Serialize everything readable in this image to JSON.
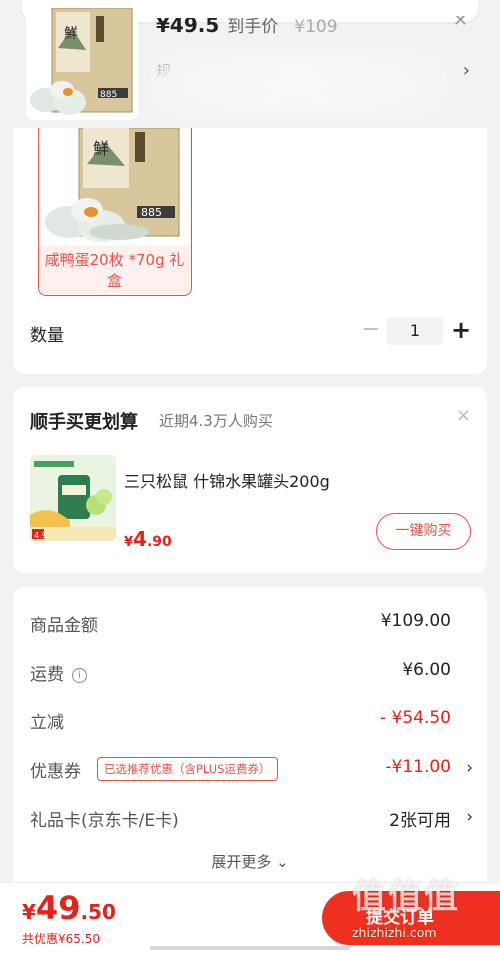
{
  "colors": {
    "accent_red": "#e2231a",
    "button_red": "#f0301e",
    "variant_border": "#e2564a",
    "page_bg": "#f2f2f2"
  },
  "top_product": {
    "price": "¥49.5",
    "price_suffix": "到手价",
    "original_price": "¥109",
    "spec_text": "规",
    "close_icon": "close-icon",
    "chevron_icon": "chevron-right-icon"
  },
  "variant": {
    "label": "咸鸭蛋20枚 *70g 礼盒",
    "selected": true
  },
  "quantity": {
    "label": "数量",
    "minus": "−",
    "value": "1",
    "plus": "+"
  },
  "add_on": {
    "title": "顺手买更划算",
    "subtitle": "近期4.3万人购买",
    "close": "×",
    "product_name": "三只松鼠  什锦水果罐头200g",
    "price_symbol": "¥",
    "price_int": "4",
    "price_dec": ".90",
    "buy_button": "一键购买"
  },
  "summary": {
    "rows": [
      {
        "label": "商品金额",
        "value": "¥109.00"
      },
      {
        "label": "运费",
        "value": "¥6.00",
        "info_icon": "ⓘ"
      },
      {
        "label": "立减",
        "value": "- ¥54.50"
      },
      {
        "label": "优惠券",
        "tag": "已选推荐优惠（含PLUS运费券）",
        "value": "-¥11.00",
        "arrow": "›"
      },
      {
        "label": "礼品卡(京东卡/E卡)",
        "value": "2张可用",
        "arrow": "›"
      }
    ],
    "expand_more": "展开更多 ⌄"
  },
  "bottom_bar": {
    "price_symbol": "¥",
    "price_int": "49",
    "price_dec": ".50",
    "total_saving": "共优惠¥65.50",
    "submit_button": "提交订单"
  },
  "watermark": {
    "big": "值值值",
    "small": "zhizhizhi.com"
  }
}
